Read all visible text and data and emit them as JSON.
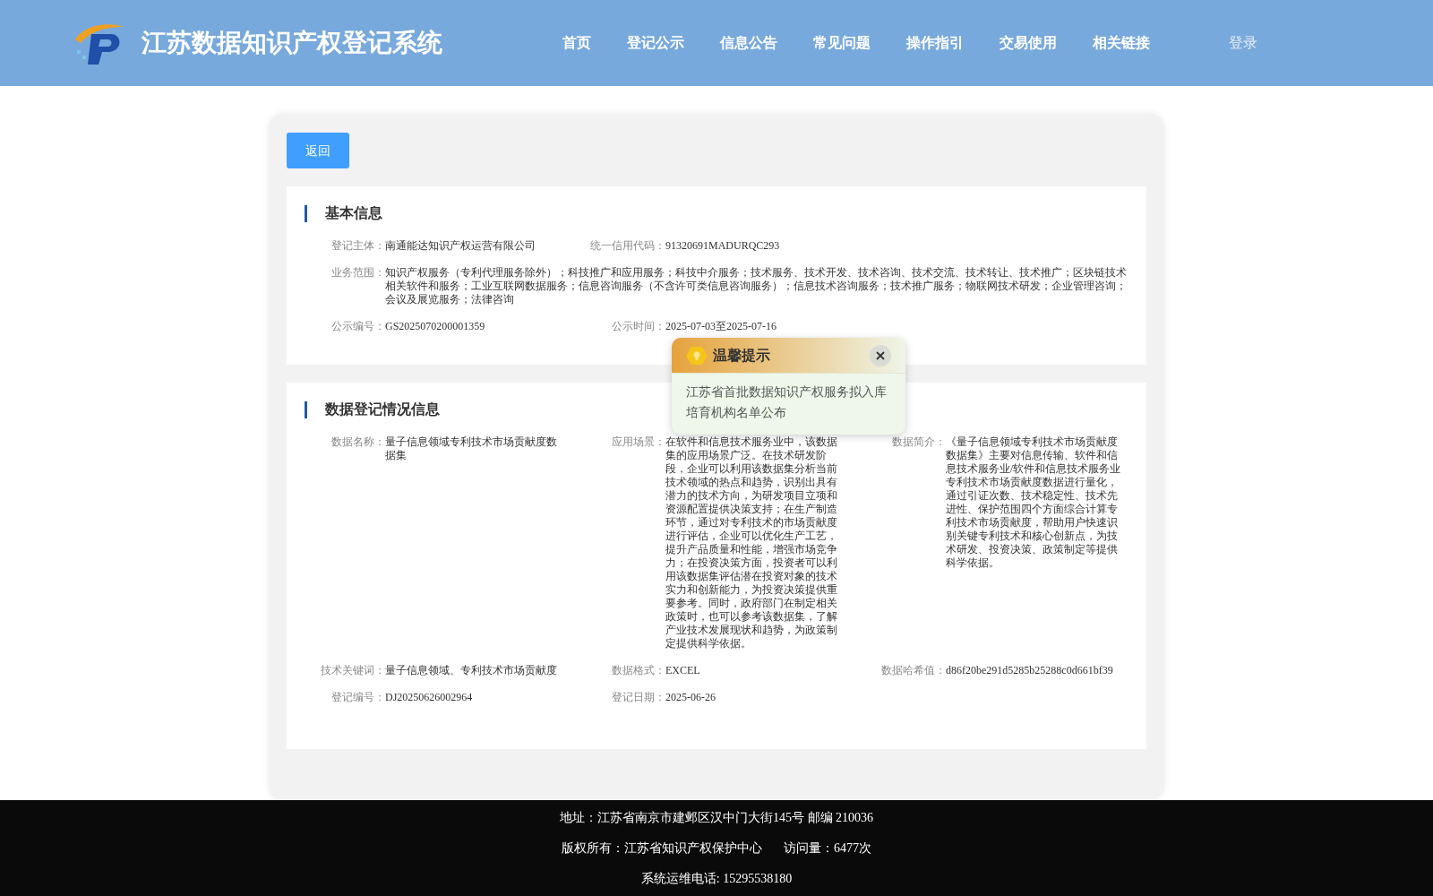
{
  "header": {
    "title": "江苏数据知识产权登记系统",
    "nav": [
      {
        "label": "首页"
      },
      {
        "label": "登记公示"
      },
      {
        "label": "信息公告"
      },
      {
        "label": "常见问题"
      },
      {
        "label": "操作指引"
      },
      {
        "label": "交易使用"
      },
      {
        "label": "相关链接"
      }
    ],
    "login": "登录"
  },
  "back_button": "返回",
  "sections": [
    {
      "title": "基本信息",
      "fields": [
        {
          "kind": "field",
          "label": "登记主体：",
          "value": "南通能达知识产权运营有限公司"
        },
        {
          "kind": "field",
          "label": "统一信用代码：",
          "value": "91320691MADURQC293"
        },
        {
          "kind": "wide",
          "label": "业务范围：",
          "value": "知识产权服务（专利代理服务除外）；科技推广和应用服务；科技中介服务；技术服务、技术开发、技术咨询、技术交流、技术转让、技术推广；区块链技术相关软件和服务；工业互联网数据服务；信息咨询服务（不含许可类信息咨询服务）；信息技术咨询服务；技术推广服务；物联网技术研发；企业管理咨询；会议及展览服务；法律咨询"
        },
        {
          "kind": "field",
          "label": "公示编号：",
          "value": "GS2025070200001359"
        },
        {
          "kind": "field",
          "label": "公示时间：",
          "value": "2025-07-03至2025-07-16"
        }
      ]
    },
    {
      "title": "数据登记情况信息",
      "fields": [
        {
          "kind": "field",
          "label": "数据名称：",
          "value": "量子信息领域专利技术市场贡献度数据集"
        },
        {
          "kind": "field",
          "label": "应用场景：",
          "value": "在软件和信息技术服务业中，该数据集的应用场景广泛。在技术研发阶段，企业可以利用该数据集分析当前技术领域的热点和趋势，识别出具有潜力的技术方向，为研发项目立项和资源配置提供决策支持；在生产制造环节，通过对专利技术的市场贡献度进行评估，企业可以优化生产工艺，提升产品质量和性能，增强市场竞争力；在投资决策方面，投资者可以利用该数据集评估潜在投资对象的技术实力和创新能力，为投资决策提供重要参考。同时，政府部门在制定相关政策时，也可以参考该数据集，了解产业技术发展现状和趋势，为政策制定提供科学依据。"
        },
        {
          "kind": "field",
          "label": "数据简介：",
          "value": "《量子信息领域专利技术市场贡献度数据集》主要对信息传输、软件和信息技术服务业/软件和信息技术服务业专利技术市场贡献度数据进行量化，通过引证次数、技术稳定性、技术先进性、保护范围四个方面综合计算专利技术市场贡献度，帮助用户快速识别关键专利技术和核心创新点，为技术研发、投资决策、政策制定等提供科学依据。"
        },
        {
          "kind": "field",
          "label": "技术关键词：",
          "value": "量子信息领域、专利技术市场贡献度"
        },
        {
          "kind": "field",
          "label": "数据格式：",
          "value": "EXCEL"
        },
        {
          "kind": "field",
          "label": "数据哈希值：",
          "value": "d86f20be291d5285b25288c0d661bf39"
        },
        {
          "kind": "field",
          "label": "登记编号：",
          "value": "DJ20250626002964"
        },
        {
          "kind": "field",
          "label": "登记日期：",
          "value": "2025-06-26"
        }
      ]
    }
  ],
  "popup": {
    "title": "温馨提示",
    "message": "江苏省首批数据知识产权服务拟入库培育机构名单公布"
  },
  "footer": {
    "address": "地址：江苏省南京市建邺区汉中门大街145号 邮编 210036",
    "copyright": "版权所有：江苏省知识产权保护中心",
    "visits": "访问量：6477次",
    "phone": "系统运维电话: 15295538180"
  }
}
